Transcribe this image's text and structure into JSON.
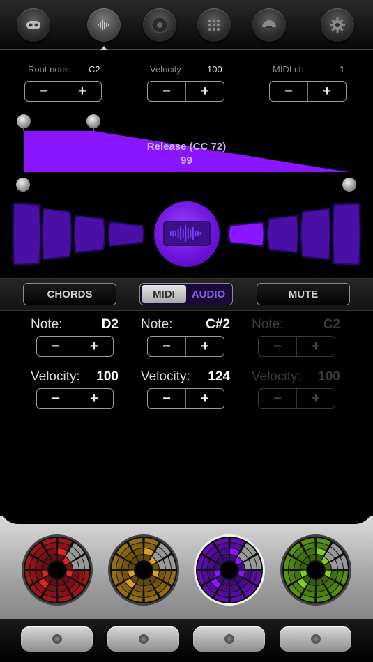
{
  "tabs": [
    {
      "icon": "gamepad-icon"
    },
    {
      "icon": "waveform-icon",
      "active": true
    },
    {
      "icon": "record-icon"
    },
    {
      "icon": "grid-dots-icon"
    },
    {
      "icon": "gauge-icon"
    },
    {
      "icon": "gear-icon"
    }
  ],
  "params": {
    "root": {
      "label": "Root note:",
      "value": "C2"
    },
    "velocity": {
      "label": "Velocity:",
      "value": "100"
    },
    "midi": {
      "label": "MIDI ch:",
      "value": "1"
    }
  },
  "stepper": {
    "minus": "−",
    "plus": "+"
  },
  "envelope": {
    "label": "Release (CC 72)",
    "value": "99",
    "color": "#8a16ff"
  },
  "modebar": {
    "chords": "CHORDS",
    "midi": "MIDI",
    "audio": "AUDIO",
    "mute": "MUTE"
  },
  "notes": [
    {
      "note_label": "Note:",
      "note": "D2",
      "vel_label": "Velocity:",
      "velocity": "100",
      "enabled": true
    },
    {
      "note_label": "Note:",
      "note": "C#2",
      "vel_label": "Velocity:",
      "velocity": "124",
      "enabled": true
    },
    {
      "note_label": "Note:",
      "note": "C2",
      "vel_label": "Velocity:",
      "velocity": "100",
      "enabled": false
    }
  ],
  "pad_colors": [
    "#e0202a",
    "#d8a01c",
    "#8a16ff",
    "#7fd21a"
  ],
  "accent": "#8a16ff"
}
